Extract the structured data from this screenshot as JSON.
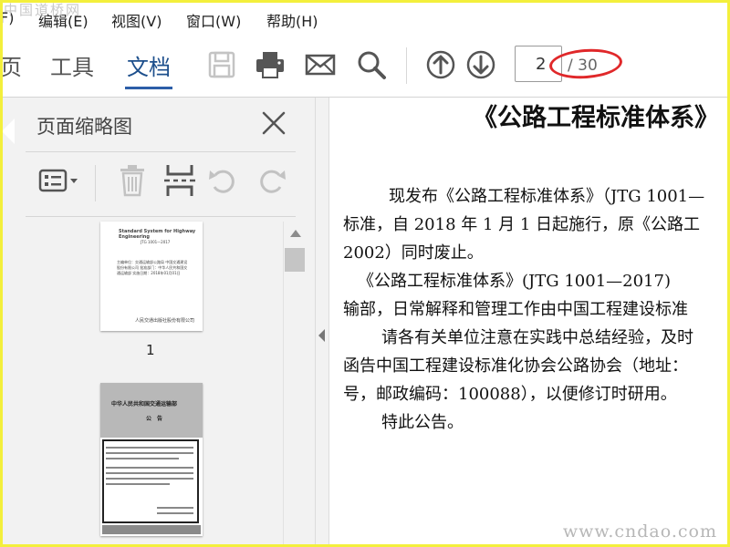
{
  "watermark": {
    "top": "中国道桥网",
    "bottom": "www.cndao.com"
  },
  "menu": [
    {
      "label": "F)"
    },
    {
      "label": "编辑(E)"
    },
    {
      "label": "视图(V)"
    },
    {
      "label": "窗口(W)"
    },
    {
      "label": "帮助(H)"
    }
  ],
  "toolbar": {
    "tabs": [
      {
        "label": "页"
      },
      {
        "label": "工具"
      },
      {
        "label": "文档"
      }
    ],
    "current_page": "2",
    "total_pages": "/ 30",
    "accent": "#2c5ea8",
    "annotation_color": "#e0282a"
  },
  "panel": {
    "title": "页面缩略图",
    "thumbnails": [
      {
        "label": "1",
        "lines": [
          "Standard System for Highway Engineering",
          "JTG 1001—2017",
          "主编单位：交通运输部公路局 中国交通建设股份有限公司 批准部门：中华人民共和国交通运输部 实施日期：2018年01月01日",
          "人民交通出版社股份有限公司"
        ]
      },
      {
        "label": "",
        "lines": [
          "中华人民共和国交通运输部",
          "公　告"
        ]
      }
    ]
  },
  "document": {
    "title": "《公路工程标准体系》",
    "paragraphs": [
      "现发布《公路工程标准体系》（JTG 1001—",
      "标准，自 2018 年 1 月 1 日起施行，原《公路工",
      "2002）同时废止。",
      "《公路工程标准体系》(JTG 1001—2017)",
      "输部，日常解释和管理工作由中国工程建设标准",
      "请各有关单位注意在实践中总结经验，及时",
      "函告中国工程建设标准化协会公路协会（地址：",
      "号，邮政编码：100088），以便修订时研用。",
      "特此公告。"
    ]
  }
}
